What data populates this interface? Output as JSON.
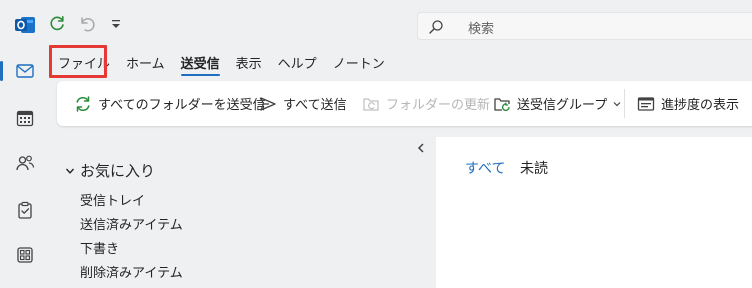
{
  "search": {
    "placeholder": "検索"
  },
  "tabs": [
    {
      "label": "ファイル"
    },
    {
      "label": "ホーム"
    },
    {
      "label": "送受信"
    },
    {
      "label": "表示"
    },
    {
      "label": "ヘルプ"
    },
    {
      "label": "ノートン"
    }
  ],
  "ribbon": {
    "send_receive_all": "すべてのフォルダーを送受信",
    "send_all": "すべて送信",
    "update_folder": "フォルダーの更新",
    "send_receive_groups": "送受信グループ",
    "show_progress": "進捗度の表示"
  },
  "favorites": {
    "header": "お気に入り",
    "items": [
      "受信トレイ",
      "送信済みアイテム",
      "下書き",
      "削除済みアイテム"
    ]
  },
  "filters": {
    "all": "すべて",
    "unread": "未読"
  },
  "colors": {
    "accent": "#1f6ebf",
    "highlight": "#e53935",
    "refresh_green": "#2e8b3a"
  }
}
